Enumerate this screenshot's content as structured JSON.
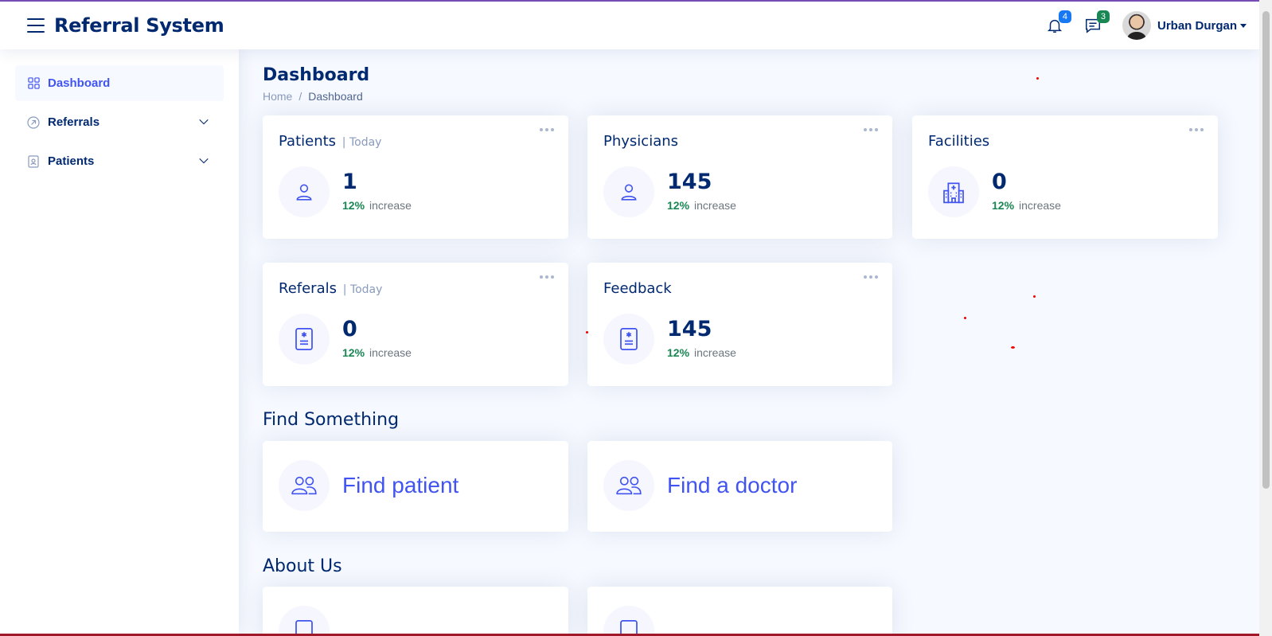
{
  "header": {
    "brand": "Referral System",
    "notifications_count": "4",
    "messages_count": "3",
    "user_name": "Urban Durgan",
    "icons": [
      "menu-icon",
      "bell-icon",
      "chat-icon"
    ]
  },
  "sidebar": {
    "items": [
      {
        "label": "Dashboard",
        "icon": "grid-icon",
        "active": true
      },
      {
        "label": "Referrals",
        "icon": "arrow-circle-icon",
        "expandable": true
      },
      {
        "label": "Patients",
        "icon": "person-badge-icon",
        "expandable": true
      }
    ]
  },
  "page": {
    "title": "Dashboard",
    "breadcrumb": [
      "Home",
      "Dashboard"
    ]
  },
  "stats": [
    {
      "title": "Patients",
      "subtitle": "| Today",
      "value": "1",
      "pct": "12%",
      "trend": "increase",
      "icon": "person-icon"
    },
    {
      "title": "Physicians",
      "subtitle": "",
      "value": "145",
      "pct": "12%",
      "trend": "increase",
      "icon": "person-icon"
    },
    {
      "title": "Facilities",
      "subtitle": "",
      "value": "0",
      "pct": "12%",
      "trend": "increase",
      "icon": "hospital-icon"
    },
    {
      "title": "Referals",
      "subtitle": "| Today",
      "value": "0",
      "pct": "12%",
      "trend": "increase",
      "icon": "file-medical-icon"
    },
    {
      "title": "Feedback",
      "subtitle": "",
      "value": "145",
      "pct": "12%",
      "trend": "increase",
      "icon": "file-medical-icon"
    }
  ],
  "find": {
    "heading": "Find Something",
    "items": [
      {
        "label": "Find patient",
        "icon": "people-icon"
      },
      {
        "label": "Find a doctor",
        "icon": "people-icon"
      }
    ]
  },
  "about": {
    "heading": "About Us"
  },
  "colors": {
    "primary": "#4154f1",
    "navy": "#012970",
    "success": "#198754",
    "bg": "#f6f9ff"
  }
}
